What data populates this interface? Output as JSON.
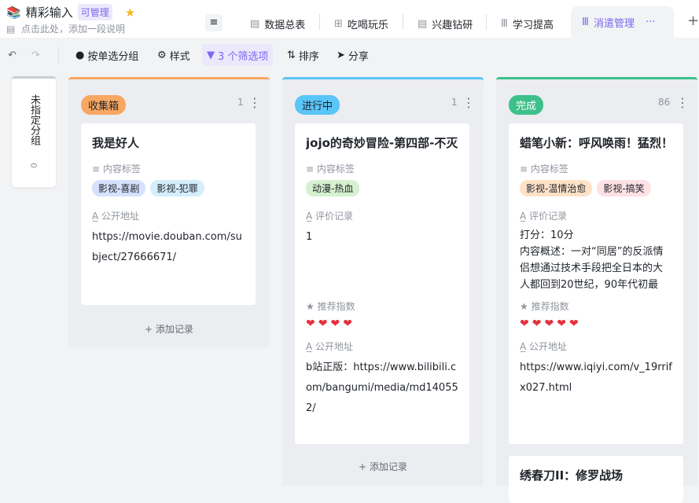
{
  "header": {
    "title": "精彩输入",
    "badge": "可管理",
    "description": "点击此处，添加一段说明"
  },
  "tabs": [
    {
      "label": "数据总表",
      "icon": "grid-table-icon"
    },
    {
      "label": "吃喝玩乐",
      "icon": "gallery-icon"
    },
    {
      "label": "兴趣钻研",
      "icon": "grid-table-icon"
    },
    {
      "label": "学习提高",
      "icon": "kanban-icon"
    },
    {
      "label": "消遣管理",
      "icon": "kanban-icon",
      "active": true
    }
  ],
  "toolbar": {
    "group": "按单选分组",
    "style": "样式",
    "filter": "3 个筛选项",
    "sort": "排序",
    "share": "分享"
  },
  "ungrouped": {
    "label": "未指定分组",
    "count": "0"
  },
  "columns": [
    {
      "name": "收集箱",
      "count": "1",
      "color": "#f8a763",
      "chip_bg": "#f8a763",
      "cards": [
        {
          "title": "我是好人",
          "tags_label": "内容标签",
          "tags": [
            "影视-喜剧",
            "影视-犯罪"
          ],
          "url_label": "公开地址",
          "url": "https://movie.douban.com/subject/27666671/"
        }
      ],
      "add": "添加记录"
    },
    {
      "name": "进行中",
      "count": "1",
      "color": "#5bc5f7",
      "cards": [
        {
          "title": "jojo的奇妙冒险-第四部-不灭钻石",
          "tags_label": "内容标签",
          "tags": [
            "动漫-热血"
          ],
          "review_label": "评价记录",
          "review": "1",
          "rating_label": "推荐指数",
          "rating": 4,
          "url_label": "公开地址",
          "url": "b站正版：https://www.bilibili.com/bangumi/media/md140552/"
        }
      ],
      "add": "添加记录"
    },
    {
      "name": "完成",
      "count": "86",
      "color": "#3ec08a",
      "cards": [
        {
          "title": "蜡笔小新：呼风唤雨！猛烈！",
          "tags_label": "内容标签",
          "tags": [
            "影视-温情治愈",
            "影视-搞笑"
          ],
          "review_label": "评价记录",
          "review_lines": [
            "打分：10分",
            "内容概述：一对“同居”的反派情侣想通过技术手段把全日本的大人都回到20世纪，90年代初最"
          ],
          "rating_label": "推荐指数",
          "rating": 5,
          "url_label": "公开地址",
          "url": "https://www.iqiyi.com/v_19rrifx027.html"
        },
        {
          "title": "绣春刀II：修罗战场"
        }
      ]
    }
  ]
}
